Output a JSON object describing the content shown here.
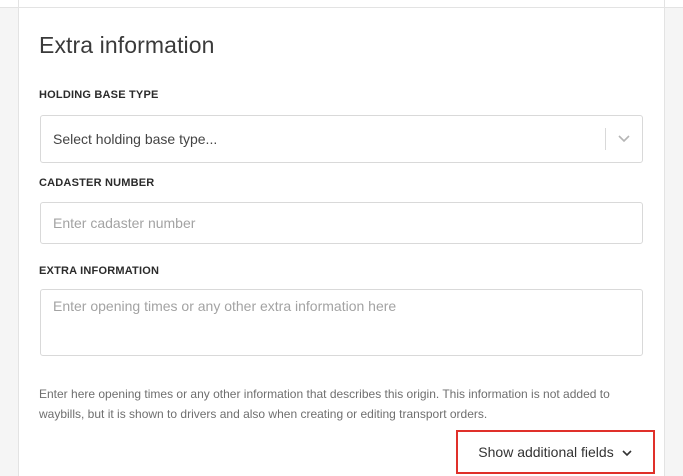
{
  "section": {
    "title": "Extra information"
  },
  "holding_base_type": {
    "label": "HOLDING BASE TYPE",
    "placeholder": "Select holding base type...",
    "chevron_icon": "chevron-down-icon"
  },
  "cadaster_number": {
    "label": "CADASTER NUMBER",
    "placeholder": "Enter cadaster number",
    "value": ""
  },
  "extra_information": {
    "label": "EXTRA INFORMATION",
    "placeholder": "Enter opening times or any other extra information here",
    "value": "",
    "help_text": "Enter here opening times or any other information that describes this origin. This information is not added to waybills, but it is shown to drivers and also when creating or editing transport orders."
  },
  "show_additional": {
    "label": "Show additional fields",
    "icon": "chevron-down-icon",
    "highlight_color": "#e0302a"
  }
}
